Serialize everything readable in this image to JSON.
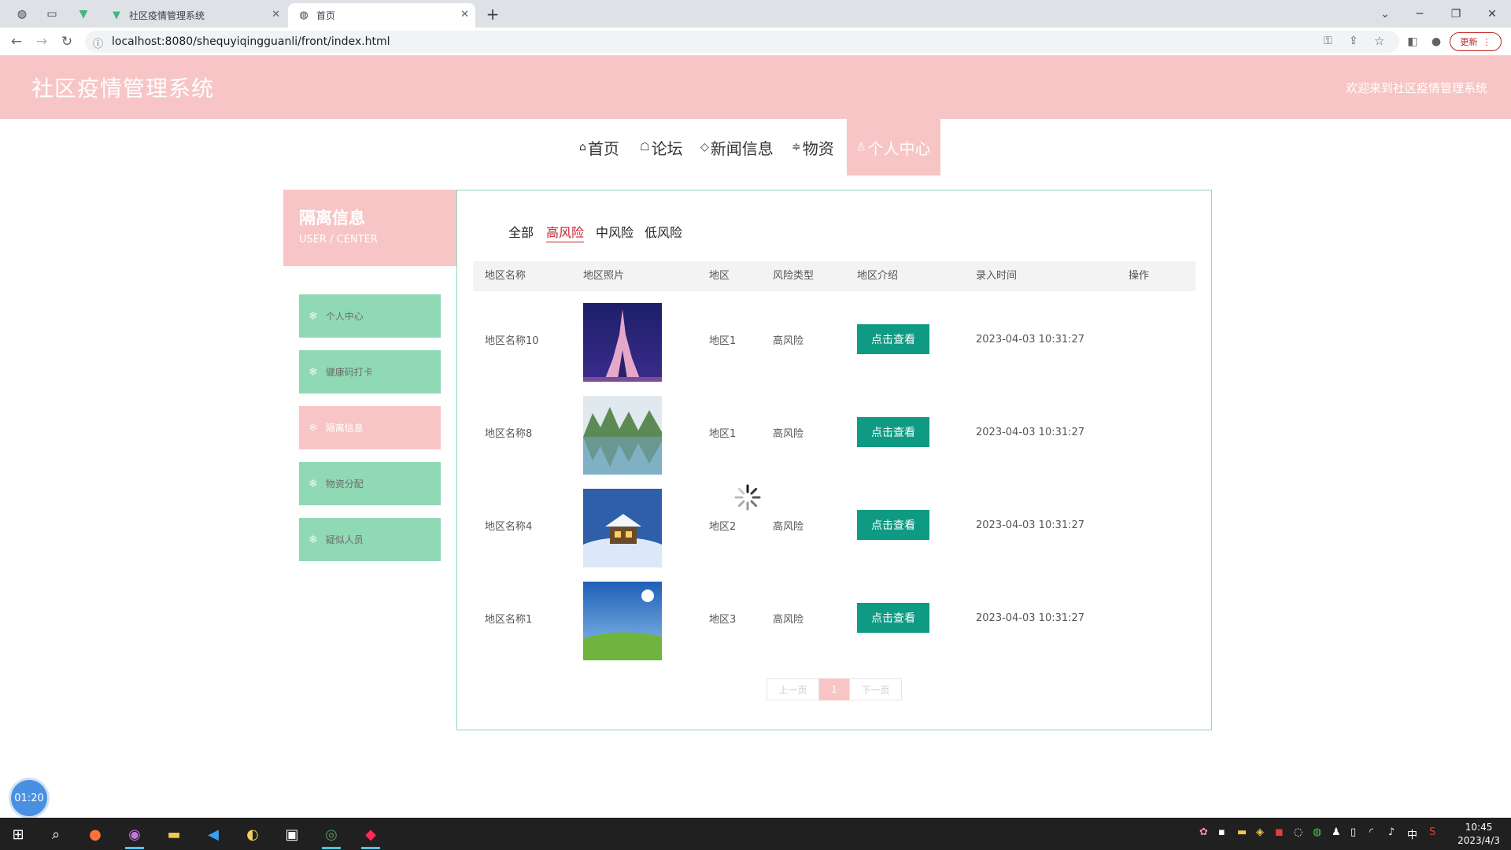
{
  "browser": {
    "tabs": [
      {
        "title": "社区疫情管理系统",
        "icon": "vue-logo-icon"
      },
      {
        "title": "首页",
        "icon": "globe-icon"
      }
    ],
    "url": "localhost:8080/shequyiqingguanli/front/index.html",
    "update_label": "更新"
  },
  "header": {
    "site_title": "社区疫情管理系统",
    "welcome": "欢迎来到社区疫情管理系统"
  },
  "nav": [
    {
      "label": "首页",
      "icon": "home-icon",
      "active": false
    },
    {
      "label": "论坛",
      "icon": "forum-icon",
      "active": false
    },
    {
      "label": "新闻信息",
      "icon": "tag-icon",
      "active": false
    },
    {
      "label": "物资",
      "icon": "sliders-icon",
      "active": false
    },
    {
      "label": "个人中心",
      "icon": "user-icon",
      "active": true
    }
  ],
  "sidebar": {
    "title": "隔离信息",
    "subtitle": "USER / CENTER",
    "items": [
      {
        "label": "个人中心",
        "active": false
      },
      {
        "label": "健康码打卡",
        "active": false
      },
      {
        "label": "隔离信息",
        "active": true
      },
      {
        "label": "物资分配",
        "active": false
      },
      {
        "label": "疑似人员",
        "active": false
      }
    ]
  },
  "filters": [
    {
      "label": "全部",
      "active": false
    },
    {
      "label": "高风险",
      "active": true
    },
    {
      "label": "中风险",
      "active": false
    },
    {
      "label": "低风险",
      "active": false
    }
  ],
  "table": {
    "columns": [
      "地区名称",
      "地区照片",
      "地区",
      "风险类型",
      "地区介绍",
      "录入时间",
      "操作"
    ],
    "rows": [
      {
        "name": "地区名称10",
        "photo": "eiffel-tower-photo",
        "region": "地区1",
        "risk": "高风险",
        "action": "点击查看",
        "time": "2023-04-03 10:31:27"
      },
      {
        "name": "地区名称8",
        "photo": "lake-mountains-photo",
        "region": "地区1",
        "risk": "高风险",
        "action": "点击查看",
        "time": "2023-04-03 10:31:27"
      },
      {
        "name": "地区名称4",
        "photo": "snow-cabin-photo",
        "region": "地区2",
        "risk": "高风险",
        "action": "点击查看",
        "time": "2023-04-03 10:31:27"
      },
      {
        "name": "地区名称1",
        "photo": "sky-meadow-photo",
        "region": "地区3",
        "risk": "高风险",
        "action": "点击查看",
        "time": "2023-04-03 10:31:27"
      }
    ]
  },
  "pager": {
    "prev": "上一页",
    "current": "1",
    "next": "下一页"
  },
  "timer": "01:20",
  "taskbar": {
    "time": "10:45",
    "date": "2023/4/3",
    "ime": "中"
  },
  "colors": {
    "header_pink": "#f7c5c5",
    "side_green": "#90d9b5",
    "button_teal": "#0f9a84",
    "filter_red": "#c7202b"
  }
}
